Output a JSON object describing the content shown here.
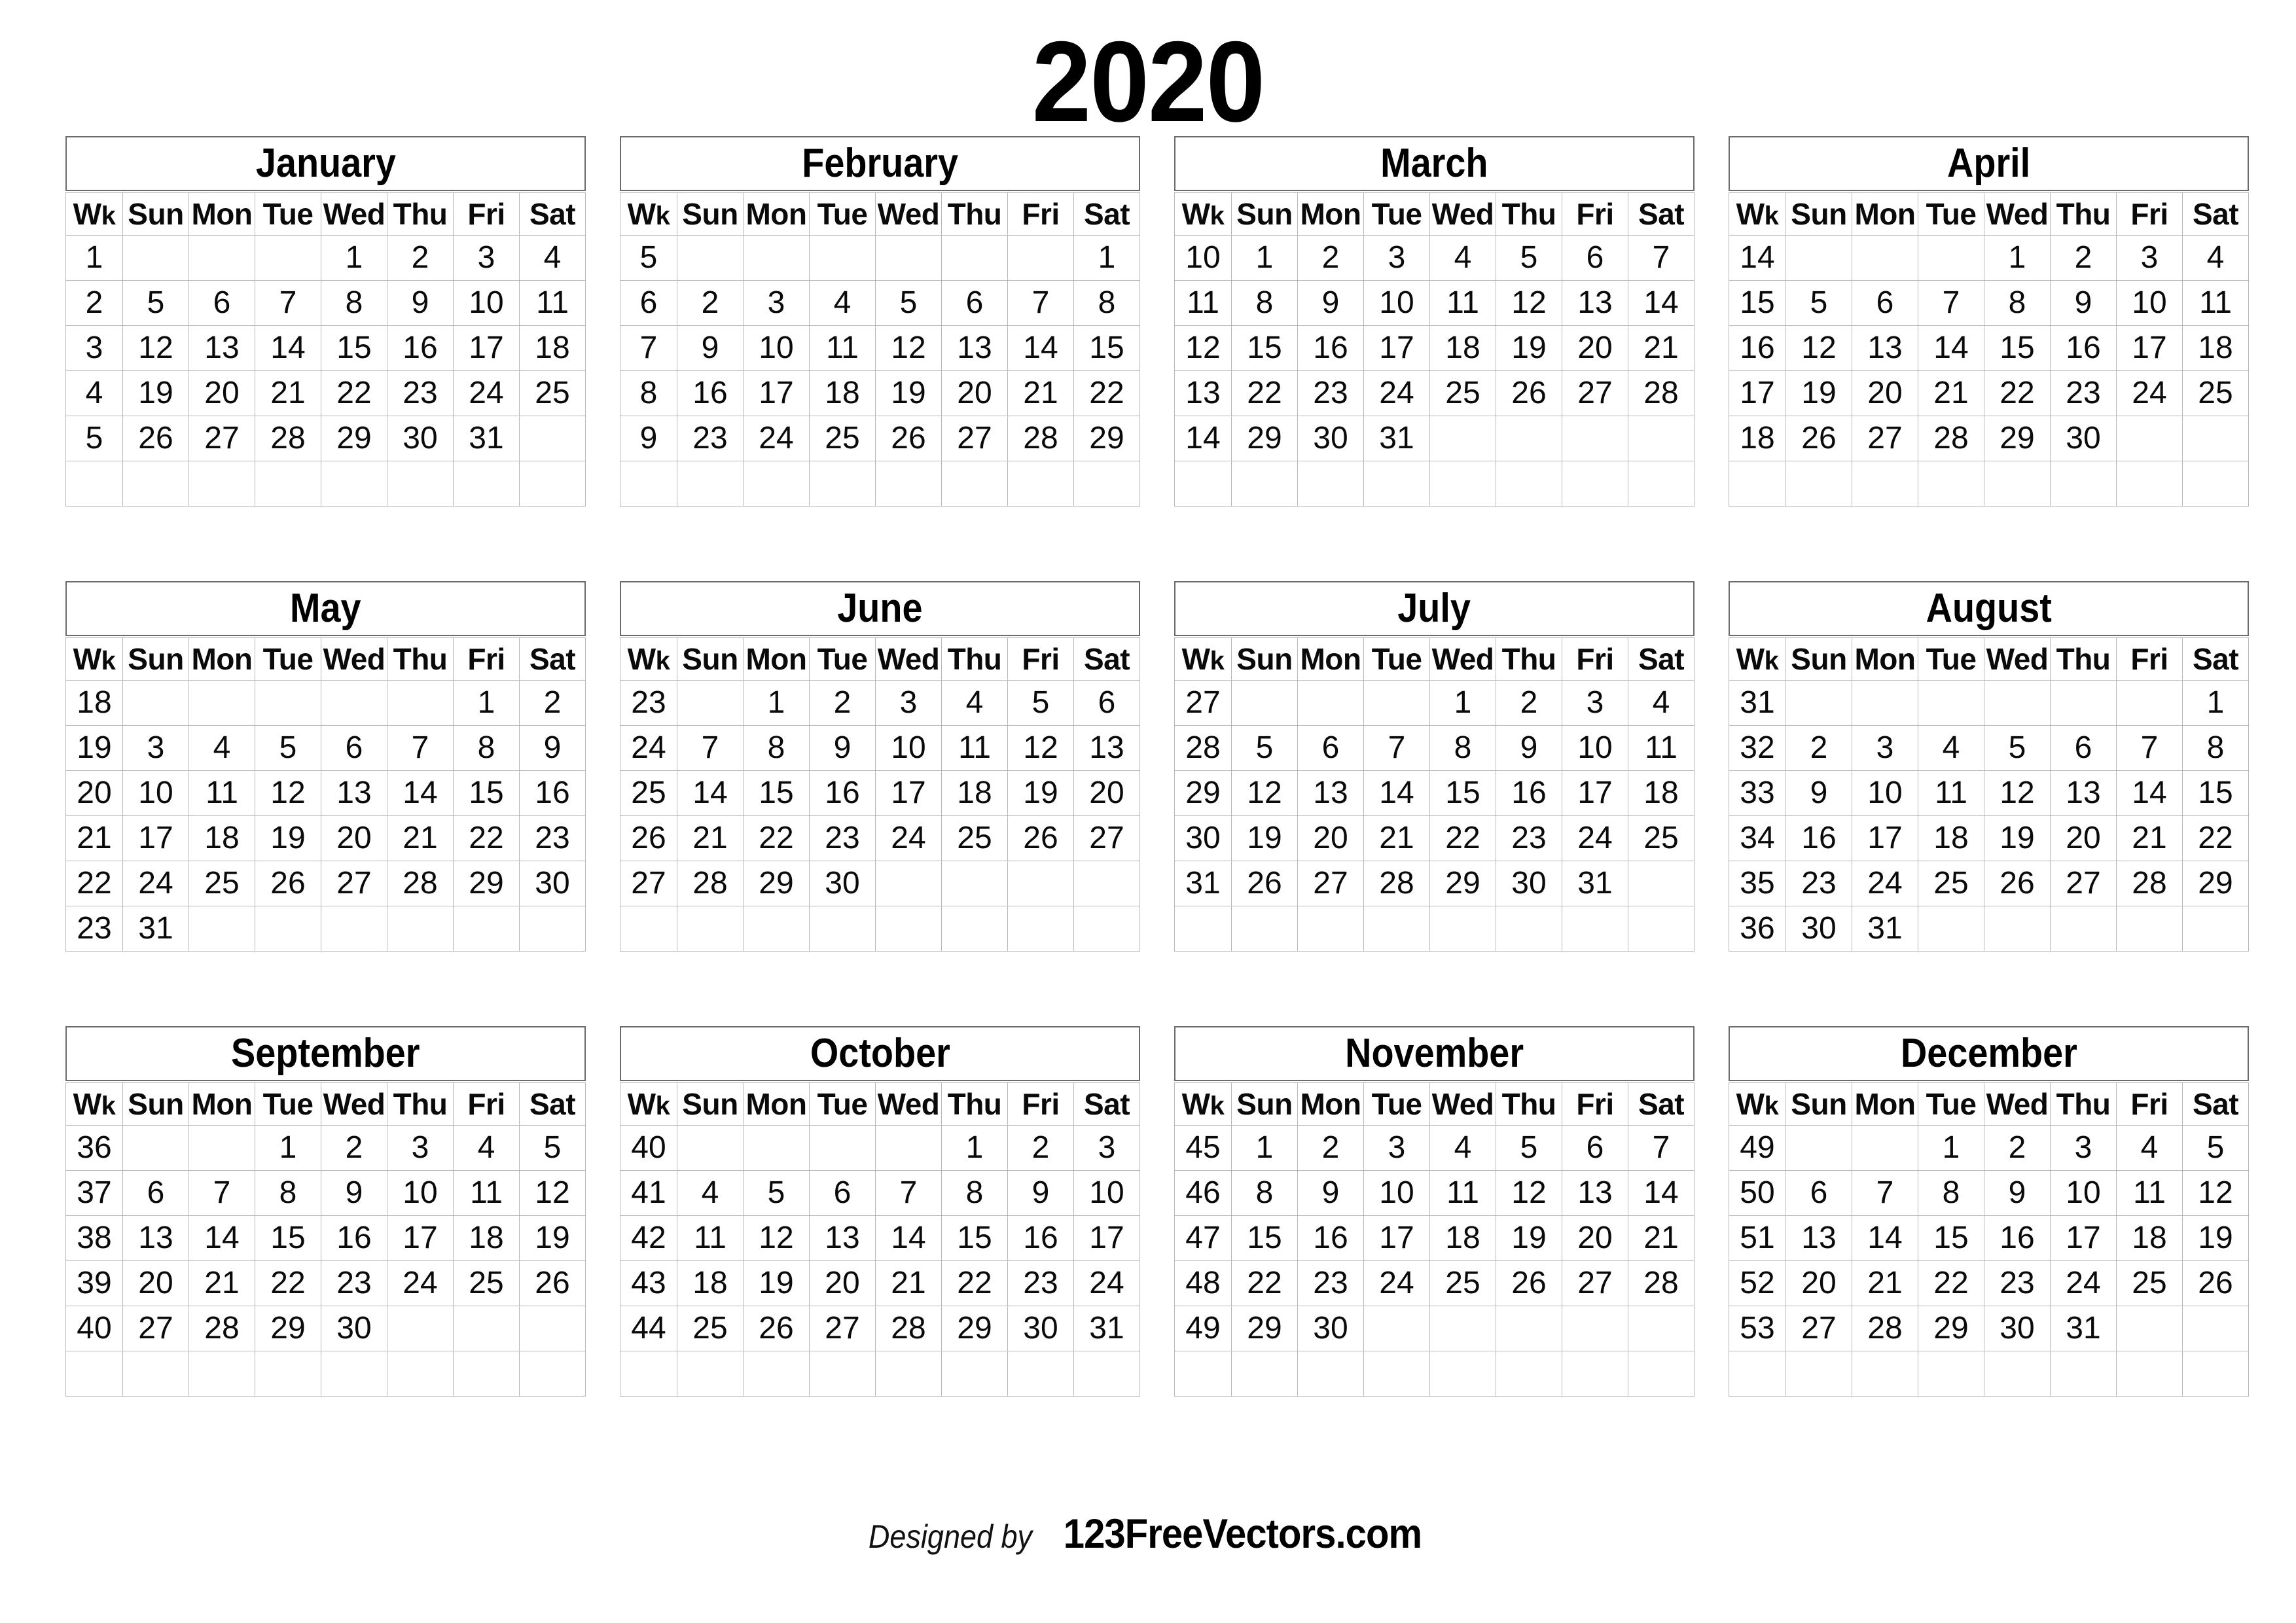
{
  "year_title": "2020",
  "column_headers": [
    "Wk",
    "Sun",
    "Mon",
    "Tue",
    "Wed",
    "Thu",
    "Fri",
    "Sat"
  ],
  "colors": {
    "sunday": "#ff0000",
    "weekday": "#0a0a0a",
    "week_number": "#777777",
    "grid_line": "#b8b8b8",
    "title_box_border": "#6b6b6b"
  },
  "footer": {
    "designed_by": "Designed by",
    "brand": "123FreeVectors.com"
  },
  "months": [
    {
      "name": "January",
      "weeks": [
        {
          "wk": "1",
          "days": [
            "",
            "",
            "",
            "1",
            "2",
            "3",
            "4"
          ]
        },
        {
          "wk": "2",
          "days": [
            "5",
            "6",
            "7",
            "8",
            "9",
            "10",
            "11"
          ]
        },
        {
          "wk": "3",
          "days": [
            "12",
            "13",
            "14",
            "15",
            "16",
            "17",
            "18"
          ]
        },
        {
          "wk": "4",
          "days": [
            "19",
            "20",
            "21",
            "22",
            "23",
            "24",
            "25"
          ]
        },
        {
          "wk": "5",
          "days": [
            "26",
            "27",
            "28",
            "29",
            "30",
            "31",
            ""
          ]
        },
        {
          "wk": "",
          "days": [
            "",
            "",
            "",
            "",
            "",
            "",
            ""
          ]
        }
      ]
    },
    {
      "name": "February",
      "weeks": [
        {
          "wk": "5",
          "days": [
            "",
            "",
            "",
            "",
            "",
            "",
            "1"
          ]
        },
        {
          "wk": "6",
          "days": [
            "2",
            "3",
            "4",
            "5",
            "6",
            "7",
            "8"
          ]
        },
        {
          "wk": "7",
          "days": [
            "9",
            "10",
            "11",
            "12",
            "13",
            "14",
            "15"
          ]
        },
        {
          "wk": "8",
          "days": [
            "16",
            "17",
            "18",
            "19",
            "20",
            "21",
            "22"
          ]
        },
        {
          "wk": "9",
          "days": [
            "23",
            "24",
            "25",
            "26",
            "27",
            "28",
            "29"
          ]
        },
        {
          "wk": "",
          "days": [
            "",
            "",
            "",
            "",
            "",
            "",
            ""
          ]
        }
      ]
    },
    {
      "name": "March",
      "weeks": [
        {
          "wk": "10",
          "days": [
            "1",
            "2",
            "3",
            "4",
            "5",
            "6",
            "7"
          ]
        },
        {
          "wk": "11",
          "days": [
            "8",
            "9",
            "10",
            "11",
            "12",
            "13",
            "14"
          ]
        },
        {
          "wk": "12",
          "days": [
            "15",
            "16",
            "17",
            "18",
            "19",
            "20",
            "21"
          ]
        },
        {
          "wk": "13",
          "days": [
            "22",
            "23",
            "24",
            "25",
            "26",
            "27",
            "28"
          ]
        },
        {
          "wk": "14",
          "days": [
            "29",
            "30",
            "31",
            "",
            "",
            "",
            ""
          ]
        },
        {
          "wk": "",
          "days": [
            "",
            "",
            "",
            "",
            "",
            "",
            ""
          ]
        }
      ]
    },
    {
      "name": "April",
      "weeks": [
        {
          "wk": "14",
          "days": [
            "",
            "",
            "",
            "1",
            "2",
            "3",
            "4"
          ]
        },
        {
          "wk": "15",
          "days": [
            "5",
            "6",
            "7",
            "8",
            "9",
            "10",
            "11"
          ]
        },
        {
          "wk": "16",
          "days": [
            "12",
            "13",
            "14",
            "15",
            "16",
            "17",
            "18"
          ]
        },
        {
          "wk": "17",
          "days": [
            "19",
            "20",
            "21",
            "22",
            "23",
            "24",
            "25"
          ]
        },
        {
          "wk": "18",
          "days": [
            "26",
            "27",
            "28",
            "29",
            "30",
            "",
            ""
          ]
        },
        {
          "wk": "",
          "days": [
            "",
            "",
            "",
            "",
            "",
            "",
            ""
          ]
        }
      ]
    },
    {
      "name": "May",
      "weeks": [
        {
          "wk": "18",
          "days": [
            "",
            "",
            "",
            "",
            "",
            "1",
            "2"
          ]
        },
        {
          "wk": "19",
          "days": [
            "3",
            "4",
            "5",
            "6",
            "7",
            "8",
            "9"
          ]
        },
        {
          "wk": "20",
          "days": [
            "10",
            "11",
            "12",
            "13",
            "14",
            "15",
            "16"
          ]
        },
        {
          "wk": "21",
          "days": [
            "17",
            "18",
            "19",
            "20",
            "21",
            "22",
            "23"
          ]
        },
        {
          "wk": "22",
          "days": [
            "24",
            "25",
            "26",
            "27",
            "28",
            "29",
            "30"
          ]
        },
        {
          "wk": "23",
          "days": [
            "31",
            "",
            "",
            "",
            "",
            "",
            ""
          ]
        }
      ]
    },
    {
      "name": "June",
      "weeks": [
        {
          "wk": "23",
          "days": [
            "",
            "1",
            "2",
            "3",
            "4",
            "5",
            "6"
          ]
        },
        {
          "wk": "24",
          "days": [
            "7",
            "8",
            "9",
            "10",
            "11",
            "12",
            "13"
          ]
        },
        {
          "wk": "25",
          "days": [
            "14",
            "15",
            "16",
            "17",
            "18",
            "19",
            "20"
          ]
        },
        {
          "wk": "26",
          "days": [
            "21",
            "22",
            "23",
            "24",
            "25",
            "26",
            "27"
          ]
        },
        {
          "wk": "27",
          "days": [
            "28",
            "29",
            "30",
            "",
            "",
            "",
            ""
          ]
        },
        {
          "wk": "",
          "days": [
            "",
            "",
            "",
            "",
            "",
            "",
            ""
          ]
        }
      ]
    },
    {
      "name": "July",
      "weeks": [
        {
          "wk": "27",
          "days": [
            "",
            "",
            "",
            "1",
            "2",
            "3",
            "4"
          ]
        },
        {
          "wk": "28",
          "days": [
            "5",
            "6",
            "7",
            "8",
            "9",
            "10",
            "11"
          ]
        },
        {
          "wk": "29",
          "days": [
            "12",
            "13",
            "14",
            "15",
            "16",
            "17",
            "18"
          ]
        },
        {
          "wk": "30",
          "days": [
            "19",
            "20",
            "21",
            "22",
            "23",
            "24",
            "25"
          ]
        },
        {
          "wk": "31",
          "days": [
            "26",
            "27",
            "28",
            "29",
            "30",
            "31",
            ""
          ]
        },
        {
          "wk": "",
          "days": [
            "",
            "",
            "",
            "",
            "",
            "",
            ""
          ]
        }
      ]
    },
    {
      "name": "August",
      "weeks": [
        {
          "wk": "31",
          "days": [
            "",
            "",
            "",
            "",
            "",
            "",
            "1"
          ]
        },
        {
          "wk": "32",
          "days": [
            "2",
            "3",
            "4",
            "5",
            "6",
            "7",
            "8"
          ]
        },
        {
          "wk": "33",
          "days": [
            "9",
            "10",
            "11",
            "12",
            "13",
            "14",
            "15"
          ]
        },
        {
          "wk": "34",
          "days": [
            "16",
            "17",
            "18",
            "19",
            "20",
            "21",
            "22"
          ]
        },
        {
          "wk": "35",
          "days": [
            "23",
            "24",
            "25",
            "26",
            "27",
            "28",
            "29"
          ]
        },
        {
          "wk": "36",
          "days": [
            "30",
            "31",
            "",
            "",
            "",
            "",
            ""
          ]
        }
      ]
    },
    {
      "name": "September",
      "weeks": [
        {
          "wk": "36",
          "days": [
            "",
            "",
            "1",
            "2",
            "3",
            "4",
            "5"
          ]
        },
        {
          "wk": "37",
          "days": [
            "6",
            "7",
            "8",
            "9",
            "10",
            "11",
            "12"
          ]
        },
        {
          "wk": "38",
          "days": [
            "13",
            "14",
            "15",
            "16",
            "17",
            "18",
            "19"
          ]
        },
        {
          "wk": "39",
          "days": [
            "20",
            "21",
            "22",
            "23",
            "24",
            "25",
            "26"
          ]
        },
        {
          "wk": "40",
          "days": [
            "27",
            "28",
            "29",
            "30",
            "",
            "",
            ""
          ]
        },
        {
          "wk": "",
          "days": [
            "",
            "",
            "",
            "",
            "",
            "",
            ""
          ]
        }
      ]
    },
    {
      "name": "October",
      "weeks": [
        {
          "wk": "40",
          "days": [
            "",
            "",
            "",
            "",
            "1",
            "2",
            "3"
          ]
        },
        {
          "wk": "41",
          "days": [
            "4",
            "5",
            "6",
            "7",
            "8",
            "9",
            "10"
          ]
        },
        {
          "wk": "42",
          "days": [
            "11",
            "12",
            "13",
            "14",
            "15",
            "16",
            "17"
          ]
        },
        {
          "wk": "43",
          "days": [
            "18",
            "19",
            "20",
            "21",
            "22",
            "23",
            "24"
          ]
        },
        {
          "wk": "44",
          "days": [
            "25",
            "26",
            "27",
            "28",
            "29",
            "30",
            "31"
          ]
        },
        {
          "wk": "",
          "days": [
            "",
            "",
            "",
            "",
            "",
            "",
            ""
          ]
        }
      ]
    },
    {
      "name": "November",
      "weeks": [
        {
          "wk": "45",
          "days": [
            "1",
            "2",
            "3",
            "4",
            "5",
            "6",
            "7"
          ]
        },
        {
          "wk": "46",
          "days": [
            "8",
            "9",
            "10",
            "11",
            "12",
            "13",
            "14"
          ]
        },
        {
          "wk": "47",
          "days": [
            "15",
            "16",
            "17",
            "18",
            "19",
            "20",
            "21"
          ]
        },
        {
          "wk": "48",
          "days": [
            "22",
            "23",
            "24",
            "25",
            "26",
            "27",
            "28"
          ]
        },
        {
          "wk": "49",
          "days": [
            "29",
            "30",
            "",
            "",
            "",
            "",
            ""
          ]
        },
        {
          "wk": "",
          "days": [
            "",
            "",
            "",
            "",
            "",
            "",
            ""
          ]
        }
      ]
    },
    {
      "name": "December",
      "weeks": [
        {
          "wk": "49",
          "days": [
            "",
            "",
            "1",
            "2",
            "3",
            "4",
            "5"
          ]
        },
        {
          "wk": "50",
          "days": [
            "6",
            "7",
            "8",
            "9",
            "10",
            "11",
            "12"
          ]
        },
        {
          "wk": "51",
          "days": [
            "13",
            "14",
            "15",
            "16",
            "17",
            "18",
            "19"
          ]
        },
        {
          "wk": "52",
          "days": [
            "20",
            "21",
            "22",
            "23",
            "24",
            "25",
            "26"
          ]
        },
        {
          "wk": "53",
          "days": [
            "27",
            "28",
            "29",
            "30",
            "31",
            "",
            ""
          ]
        },
        {
          "wk": "",
          "days": [
            "",
            "",
            "",
            "",
            "",
            "",
            ""
          ]
        }
      ]
    }
  ]
}
